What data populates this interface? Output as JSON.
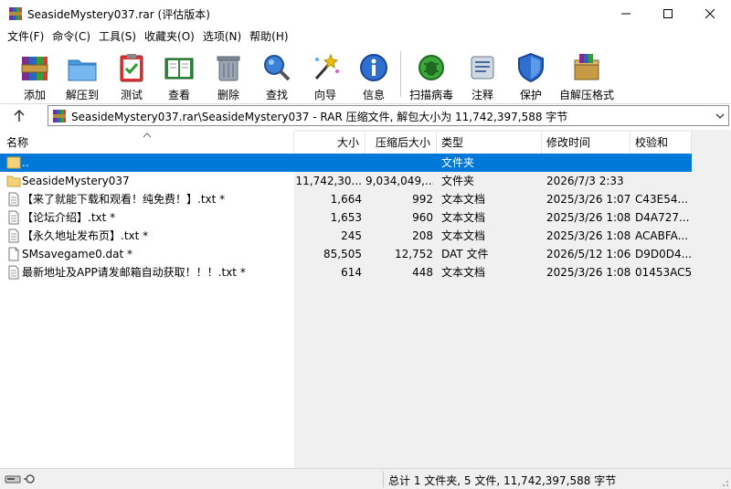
{
  "window": {
    "title": "SeasideMystery037.rar (评估版本)",
    "minimize_icon": "minimize-icon",
    "maximize_icon": "maximize-icon",
    "close_icon": "close-icon"
  },
  "menu": {
    "items": [
      {
        "label": "文件(F)"
      },
      {
        "label": "命令(C)"
      },
      {
        "label": "工具(S)"
      },
      {
        "label": "收藏夹(O)"
      },
      {
        "label": "选项(N)"
      },
      {
        "label": "帮助(H)"
      }
    ]
  },
  "toolbar": {
    "buttons": [
      {
        "label": "添加",
        "icon": "add-archive-icon"
      },
      {
        "label": "解压到",
        "icon": "extract-folder-icon"
      },
      {
        "label": "测试",
        "icon": "test-clipboard-icon"
      },
      {
        "label": "查看",
        "icon": "view-book-icon"
      },
      {
        "label": "删除",
        "icon": "trash-icon"
      },
      {
        "label": "查找",
        "icon": "magnifier-icon"
      },
      {
        "label": "向导",
        "icon": "wizard-wand-icon"
      },
      {
        "label": "信息",
        "icon": "info-icon"
      },
      {
        "label": "扫描病毒",
        "icon": "virus-scan-icon"
      },
      {
        "label": "注释",
        "icon": "comment-icon"
      },
      {
        "label": "保护",
        "icon": "shield-icon"
      },
      {
        "label": "自解压格式",
        "icon": "sfx-box-icon"
      }
    ]
  },
  "address": {
    "path": "SeasideMystery037.rar\\SeasideMystery037 - RAR 压缩文件, 解包大小为 11,742,397,588 字节"
  },
  "columns": {
    "name": "名称",
    "size": "大小",
    "packed": "压缩后大小",
    "type": "类型",
    "modified": "修改时间",
    "crc": "校验和"
  },
  "files": [
    {
      "name": "..",
      "size": "",
      "packed": "",
      "type": "文件夹",
      "modified": "",
      "crc": "",
      "icon": "folder-up-icon",
      "selected": true
    },
    {
      "name": "SeasideMystery037",
      "size": "11,742,30...",
      "packed": "9,034,049,...",
      "type": "文件夹",
      "modified": "2026/7/3 2:33",
      "crc": "",
      "icon": "folder-icon",
      "selected": false
    },
    {
      "name": "【来了就能下载和观看！纯免费！】.txt *",
      "size": "1,664",
      "packed": "992",
      "type": "文本文档",
      "modified": "2025/3/26 1:07",
      "crc": "C43E54...",
      "icon": "text-file-icon",
      "selected": false
    },
    {
      "name": "【论坛介绍】.txt *",
      "size": "1,653",
      "packed": "960",
      "type": "文本文档",
      "modified": "2025/3/26 1:08",
      "crc": "D4A727...",
      "icon": "text-file-icon",
      "selected": false
    },
    {
      "name": "【永久地址发布页】.txt *",
      "size": "245",
      "packed": "208",
      "type": "文本文档",
      "modified": "2025/3/26 1:08",
      "crc": "ACABFA...",
      "icon": "text-file-icon",
      "selected": false
    },
    {
      "name": "SMsavegame0.dat *",
      "size": "85,505",
      "packed": "12,752",
      "type": "DAT 文件",
      "modified": "2026/5/12 1:06",
      "crc": "D9D0D4...",
      "icon": "file-icon",
      "selected": false
    },
    {
      "name": "最新地址及APP请发邮箱自动获取！！！.txt *",
      "size": "614",
      "packed": "448",
      "type": "文本文档",
      "modified": "2025/3/26 1:08",
      "crc": "01453AC5",
      "icon": "text-file-icon",
      "selected": false
    }
  ],
  "status": {
    "text": "总计 1 文件夹, 5 文件, 11,742,397,588 字节"
  },
  "colors": {
    "selection": "#0078d7",
    "panel_gray": "#f0f0f0"
  }
}
